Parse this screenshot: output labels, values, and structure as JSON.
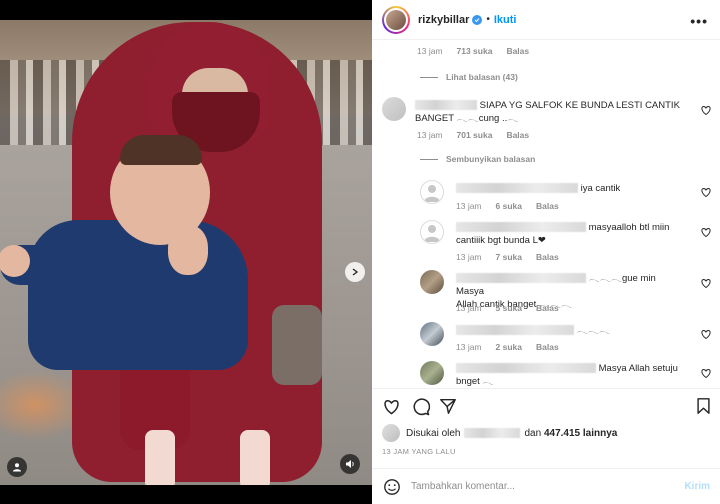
{
  "post": {
    "username": "rizkybillar",
    "follow_label": "Ikuti",
    "separator": "•",
    "more_label": "•••"
  },
  "comments": {
    "top_meta": {
      "time": "13 jam",
      "likes": "713 suka",
      "reply": "Balas"
    },
    "view_replies": "Lihat balasan (43)",
    "main": {
      "text_line1": "SIAPA YG SALFOK KE BUNDA LESTI CANTIK",
      "text_line2": "BANGET 𓂃𓂃cung ..𓂃",
      "time": "13 jam",
      "likes": "701 suka",
      "reply": "Balas"
    },
    "hide_replies": "Sembunyikan balasan",
    "replies": [
      {
        "text": "iya cantik",
        "time": "13 jam",
        "likes": "6 suka",
        "reply": "Balas"
      },
      {
        "text": "masyaalloh btl miin",
        "text2": "cantiiik bgt bunda L❤",
        "time": "13 jam",
        "likes": "7 suka",
        "reply": "Balas"
      },
      {
        "text": "𓂃𓂃𓂃gue min Masya",
        "text2": "Allah cantik banget 𓂃𓂃𓂃",
        "time": "13 jam",
        "likes": "5 suka",
        "reply": "Balas"
      },
      {
        "text": "𓂃𓂃𓂃",
        "time": "13 jam",
        "likes": "2 suka",
        "reply": "Balas"
      },
      {
        "text": "Masya Allah setuju",
        "text2": "bnget 𓂃"
      }
    ]
  },
  "likes": {
    "prefix": "Disukai oleh",
    "middle": "dan",
    "count": "447.415 lainnya"
  },
  "timestamp": "13 JAM YANG LALU",
  "comment_box": {
    "placeholder": "Tambahkan komentar...",
    "send_label": "Kirim"
  },
  "colors": {
    "accent": "#0095f6",
    "verified": "#3897f0",
    "hijab": "#8f1f2e",
    "jacket": "#1e3a6e"
  },
  "icons": [
    "heart-icon",
    "comment-icon",
    "share-icon",
    "bookmark-icon",
    "emoji-icon",
    "next-arrow-icon",
    "user-tag-icon",
    "volume-icon"
  ],
  "carousel": {
    "count": 2,
    "active_index": 0
  }
}
